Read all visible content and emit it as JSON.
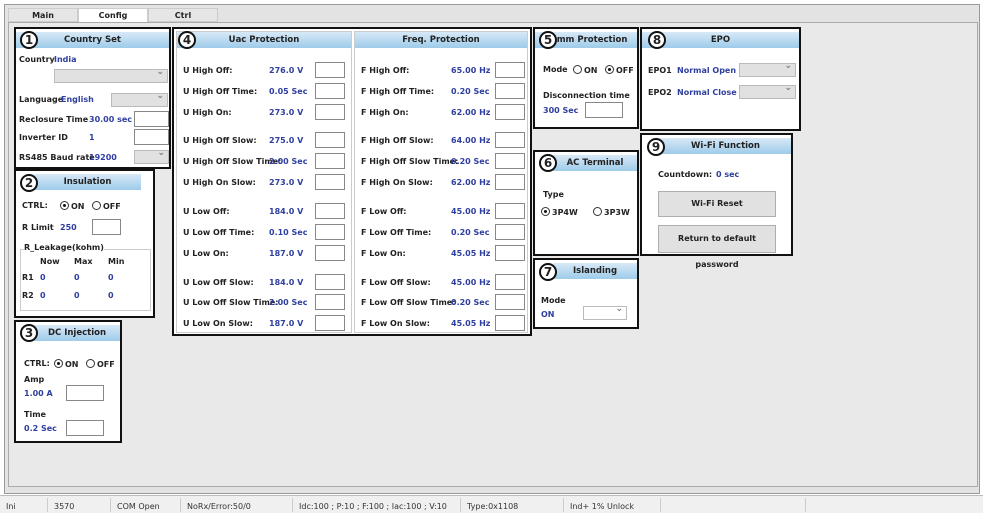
{
  "tabs": [
    "Main",
    "Config",
    "Ctrl"
  ],
  "country_set": {
    "title": "Country Set",
    "country_label": "Country",
    "country": "India",
    "language_label": "Language",
    "language": "English",
    "reclosure_label": "Reclosure Time",
    "reclosure": "30.00 sec",
    "inverter_id_label": "Inverter ID",
    "inverter_id": "1",
    "baud_label": "RS485 Baud rate",
    "baud": "19200"
  },
  "insulation": {
    "title": "Insulation",
    "ctrl": "CTRL:",
    "on": "ON",
    "off": "OFF",
    "rlimit_label": "R Limit",
    "rlimit": "250",
    "leak_title": "R_Leakage(kohm)",
    "cols": [
      "Now",
      "Max",
      "Min"
    ],
    "rows": [
      {
        "name": "R1",
        "vals": [
          "0",
          "0",
          "0"
        ]
      },
      {
        "name": "R2",
        "vals": [
          "0",
          "0",
          "0"
        ]
      }
    ]
  },
  "dc_injection": {
    "title": "DC Injection",
    "ctrl": "CTRL:",
    "on": "ON",
    "off": "OFF",
    "amp_label": "Amp",
    "amp": "1.00 A",
    "time_label": "Time",
    "time": "0.2 Sec"
  },
  "uac": {
    "title": "Uac Protection",
    "rows": [
      [
        "U High Off:",
        "276.0 V"
      ],
      [
        "U High Off Time:",
        "0.05 Sec"
      ],
      [
        "U High On:",
        "273.0 V"
      ],
      [
        "U High Off Slow:",
        "275.0 V"
      ],
      [
        "U High Off Slow Time:",
        "2.00 Sec"
      ],
      [
        "U High On Slow:",
        "273.0 V"
      ],
      [
        "U Low Off:",
        "184.0 V"
      ],
      [
        "U Low Off Time:",
        "0.10 Sec"
      ],
      [
        "U Low On:",
        "187.0 V"
      ],
      [
        "U Low Off Slow:",
        "184.0 V"
      ],
      [
        "U Low Off Slow Time:",
        "2.00 Sec"
      ],
      [
        "U Low On Slow:",
        "187.0 V"
      ]
    ]
  },
  "freq": {
    "title": "Freq. Protection",
    "rows": [
      [
        "F High Off:",
        "65.00 Hz"
      ],
      [
        "F High Off Time:",
        "0.20 Sec"
      ],
      [
        "F High On:",
        "62.00 Hz"
      ],
      [
        "F High Off Slow:",
        "64.00 Hz"
      ],
      [
        "F High Off Slow Time:",
        "0.20 Sec"
      ],
      [
        "F High On Slow:",
        "62.00 Hz"
      ],
      [
        "F Low Off:",
        "45.00 Hz"
      ],
      [
        "F Low Off Time:",
        "0.20 Sec"
      ],
      [
        "F Low On:",
        "45.05 Hz"
      ],
      [
        "F Low Off Slow:",
        "45.00 Hz"
      ],
      [
        "F Low Off Slow Time:",
        "0.20 Sec"
      ],
      [
        "F Low On Slow:",
        "45.05 Hz"
      ]
    ]
  },
  "comm": {
    "title": "Comm Protection",
    "mode_label": "Mode",
    "on": "ON",
    "off": "OFF",
    "disc_label": "Disconnection time",
    "disc": "300 Sec"
  },
  "ac_terminal": {
    "title": "AC Terminal",
    "type_label": "Type",
    "opt1": "3P4W",
    "opt2": "3P3W"
  },
  "islanding": {
    "title": "Islanding",
    "mode_label": "Mode",
    "mode": "ON"
  },
  "epo": {
    "title": "EPO",
    "epo1_label": "EPO1",
    "epo1": "Normal Open",
    "epo2_label": "EPO2",
    "epo2": "Normal Close"
  },
  "wifi": {
    "title": "Wi-Fi Function",
    "countdown_label": "Countdown:",
    "countdown": "0 sec",
    "reset": "Wi-Fi Reset",
    "default_pw": "Return to default password"
  },
  "markers": [
    "1",
    "2",
    "3",
    "4",
    "5",
    "6",
    "7",
    "8",
    "9"
  ],
  "status": [
    "Ini",
    "3570",
    "COM Open",
    "NoRx/Error:50/0",
    "Idc:100 ; P:10 ; F:100 ; Iac:100 ; V:10",
    "Type:0x1108",
    "Ind+ 1%  Unlock"
  ]
}
